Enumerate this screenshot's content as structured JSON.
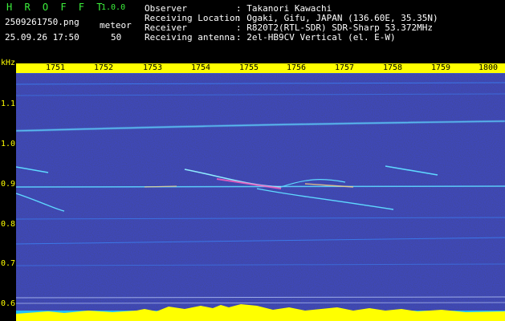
{
  "header": {
    "brand": "H R O F F T",
    "version": "1.0.0",
    "filename": "2509261750.png",
    "datetime": "25.09.26 17:50",
    "mode_label": "meteor",
    "count": "50",
    "info": [
      {
        "label": "Observer",
        "value": ": Takanori Kawachi"
      },
      {
        "label": "Receiving Location",
        "value": ": Ogaki, Gifu, JAPAN (136.60E, 35.35N)"
      },
      {
        "label": "Receiver",
        "value": ": R820T2(RTL-SDR) SDR-Sharp 53.372MHz"
      },
      {
        "label": "Receiving antenna",
        "value": ": 2el-HB9CV Vertical (el. E-W)"
      }
    ]
  },
  "axis": {
    "unit": "kHz",
    "x_ticks": [
      "1751",
      "1752",
      "1753",
      "1754",
      "1755",
      "1756",
      "1757",
      "1758",
      "1759",
      "1800"
    ],
    "y_ticks": [
      "1.1",
      "1.0",
      "0.9",
      "0.8",
      "0.7",
      "0.6"
    ]
  },
  "colors": {
    "background": "#0a0a6e",
    "noise": "#1e2aa8",
    "trace": "#5fd8ff",
    "meteor": "#ff60c0",
    "axis": "#ffff00",
    "brand": "#3cf03c",
    "level": "#20c0ff"
  }
}
